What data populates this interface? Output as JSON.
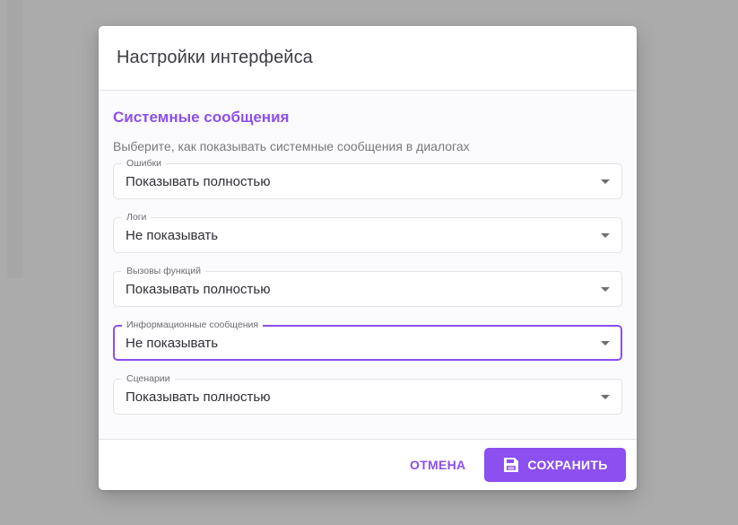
{
  "dialog": {
    "title": "Настройки интерфейса"
  },
  "section": {
    "title": "Системные сообщения",
    "description": "Выберите, как показывать системные сообщения в диалогах"
  },
  "fields": [
    {
      "label": "Ошибки",
      "value": "Показывать полностью"
    },
    {
      "label": "Логи",
      "value": "Не показывать"
    },
    {
      "label": "Вызовы функций",
      "value": "Показывать полностью"
    },
    {
      "label": "Информационные сообщения",
      "value": "Не показывать",
      "focused": true
    },
    {
      "label": "Сценарии",
      "value": "Показывать полностью"
    }
  ],
  "footer": {
    "cancel_label": "ОТМЕНА",
    "save_label": "СОХРАНИТЬ",
    "save_icon": "floppy-disk-icon"
  },
  "colors": {
    "accent": "#8c4ff0",
    "overlay": "#ababab"
  }
}
